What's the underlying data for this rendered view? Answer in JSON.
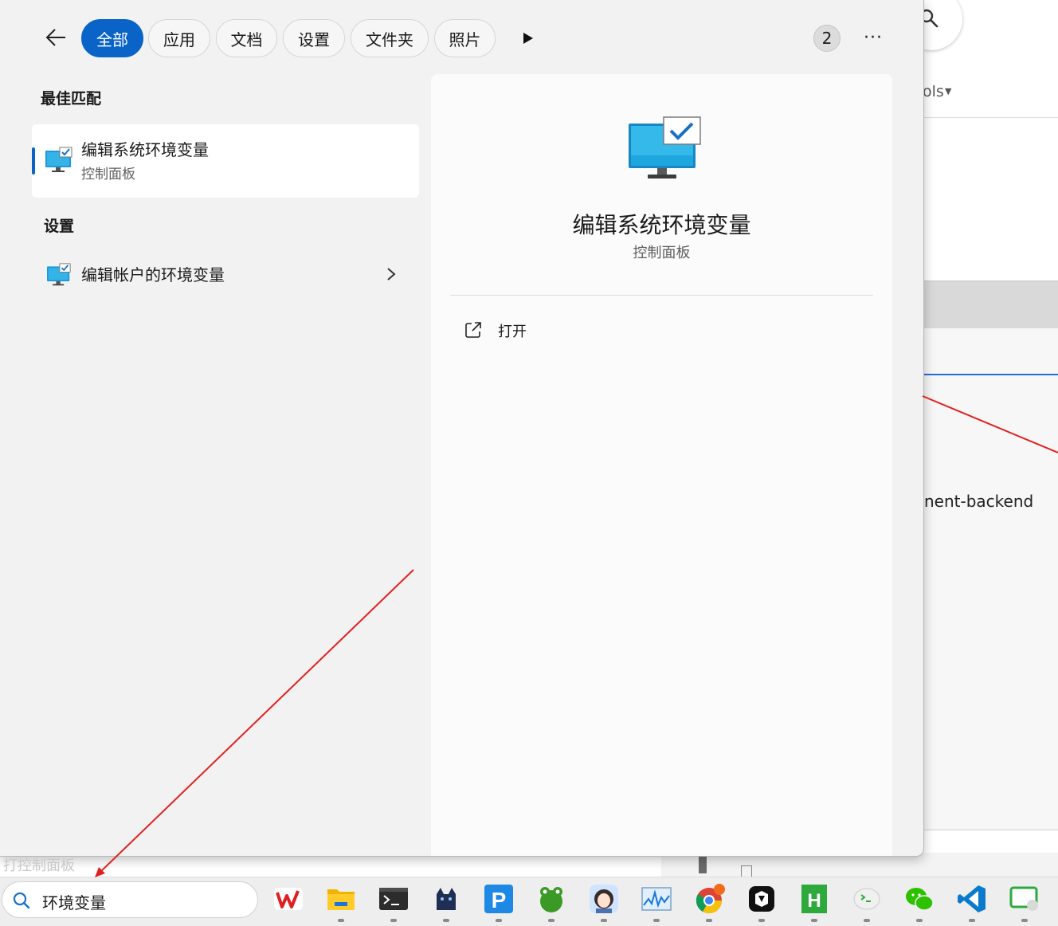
{
  "background_window": {
    "tools_label": "ols",
    "backend_text": "nent-backend"
  },
  "filter_bar": {
    "tabs": [
      {
        "label": "全部",
        "active": true
      },
      {
        "label": "应用",
        "active": false
      },
      {
        "label": "文档",
        "active": false
      },
      {
        "label": "设置",
        "active": false
      },
      {
        "label": "文件夹",
        "active": false
      },
      {
        "label": "照片",
        "active": false
      }
    ],
    "badge_count": "2",
    "more_label": "···"
  },
  "best_match": {
    "heading": "最佳匹配",
    "title": "编辑系统环境变量",
    "subtitle": "控制面板"
  },
  "settings": {
    "heading": "设置",
    "items": [
      {
        "label": "编辑帐户的环境变量"
      }
    ]
  },
  "detail": {
    "title": "编辑系统环境变量",
    "subtitle": "控制面板",
    "actions": [
      {
        "label": "打开",
        "icon": "open-external-icon"
      }
    ]
  },
  "taskbar": {
    "search_value": "环境变量",
    "ghost_text": "打控制面板",
    "apps": [
      "wps",
      "file-explorer",
      "terminal",
      "cat-app",
      "p-app",
      "frog-app",
      "avatar-app",
      "resource-monitor",
      "chrome",
      "capcut",
      "h-builder",
      "green-terminal",
      "wechat",
      "vscode",
      "screen-app"
    ]
  },
  "colors": {
    "accent": "#0a63c6",
    "annotation_red": "#e02020"
  }
}
